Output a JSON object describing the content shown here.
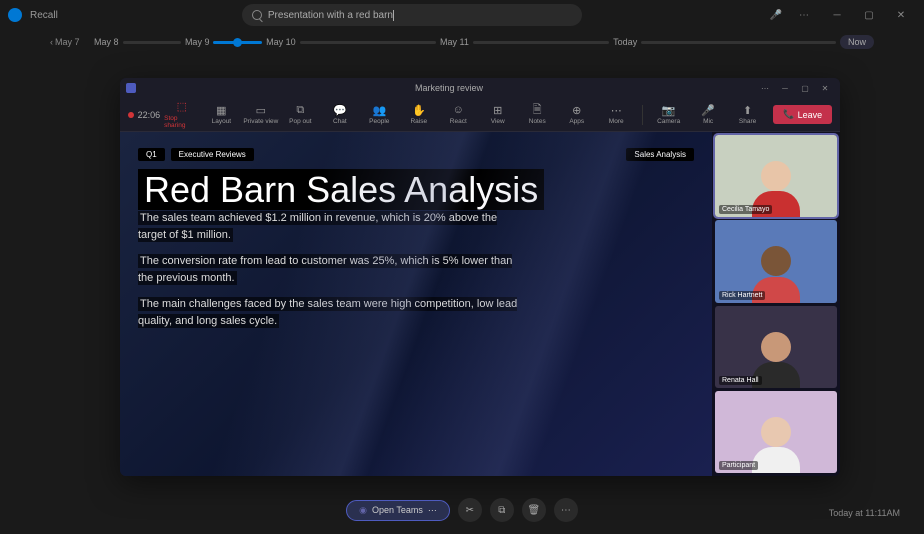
{
  "app": {
    "name": "Recall"
  },
  "search": {
    "query": "Presentation with a red barn"
  },
  "timeline": {
    "nav_date": "May 7",
    "dates": [
      "May 8",
      "May 9",
      "May 10",
      "May 11",
      "Today"
    ],
    "now_label": "Now"
  },
  "teams": {
    "window_title": "Marketing review",
    "timer": "22:06",
    "toolbar": {
      "stop_sharing": "Stop sharing",
      "layout": "Layout",
      "private_view": "Private view",
      "pop_out": "Pop out",
      "chat": "Chat",
      "people": "People",
      "raise": "Raise",
      "react": "React",
      "view": "View",
      "notes": "Notes",
      "apps": "Apps",
      "more": "More",
      "camera": "Camera",
      "mic": "Mic",
      "share": "Share"
    },
    "leave": "Leave",
    "slide": {
      "tag_q": "Q1",
      "tag_exec": "Executive Reviews",
      "tag_sales": "Sales Analysis",
      "title": "Red Barn Sales Analysis",
      "p1": "The sales team achieved $1.2 million in revenue, which is 20% above the target of $1 million.",
      "p2": "The conversion rate from lead to customer was 25%, which is 5% lower than the previous month.",
      "p3": "The main challenges faced by the sales team were high competition, low lead quality, and long sales cycle."
    },
    "participants": [
      {
        "name": "Cecilia Tamayo",
        "bg": "#c8d0c0",
        "skin": "#e8c5a8",
        "cloth": "#c93030"
      },
      {
        "name": "Rick Hartnett",
        "bg": "#5a7ab8",
        "skin": "#7a5538",
        "cloth": "#d04848"
      },
      {
        "name": "Renata Hall",
        "bg": "#383248",
        "skin": "#c89878",
        "cloth": "#2a2a2a"
      },
      {
        "name": "Participant",
        "bg": "#d0b8d8",
        "skin": "#e8c8b0",
        "cloth": "#f0f0f0"
      }
    ]
  },
  "actions": {
    "open_teams": "Open Teams"
  },
  "footer": {
    "timestamp": "Today at 11:11AM"
  }
}
